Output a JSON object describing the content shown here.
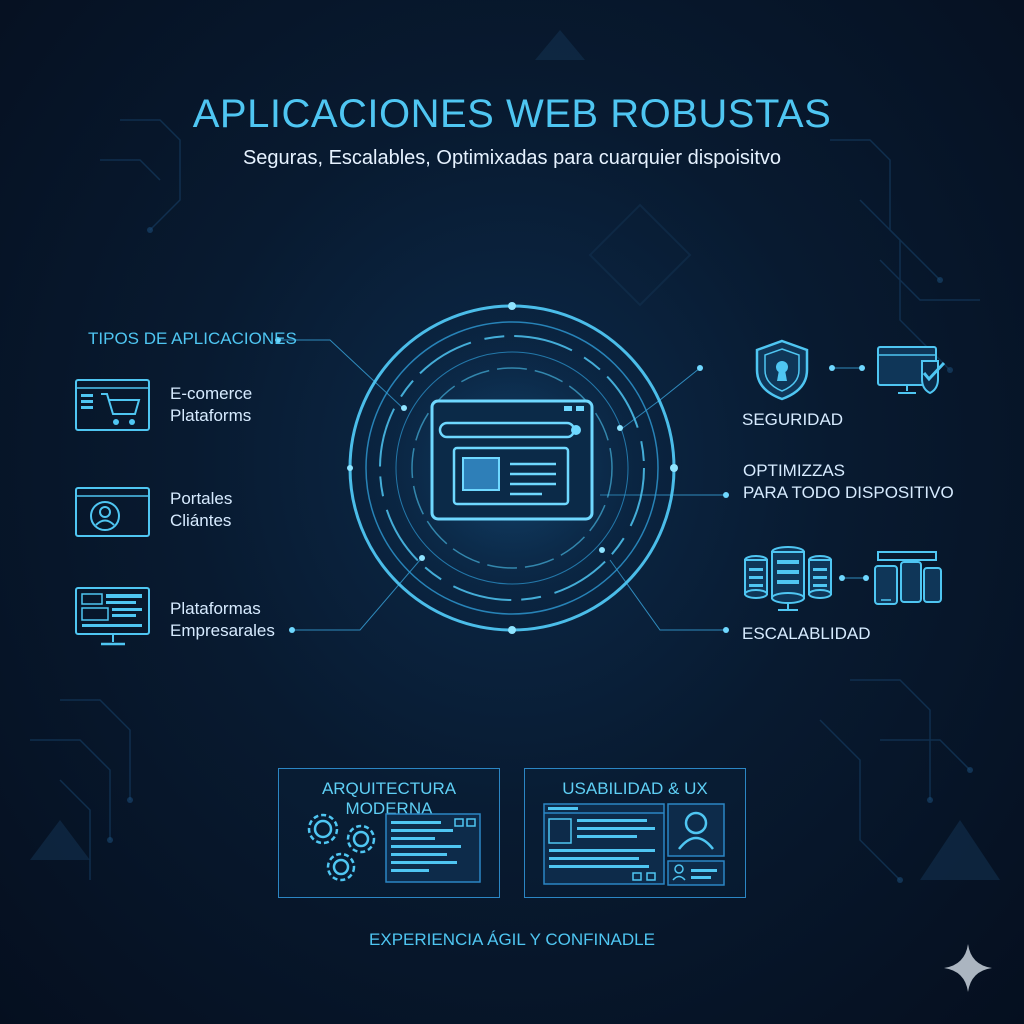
{
  "header": {
    "title": "APLICACIONES WEB ROBUSTAS",
    "subtitle": "Seguras, Escalables, Optimixadas para cuarquier dispoisitvo"
  },
  "left_panel": {
    "heading": "TIPOS DE APLICACIONES",
    "items": [
      {
        "line1": "E-comerce",
        "line2": "Plataforms",
        "icon": "shopping-cart-icon"
      },
      {
        "line1": "Portales",
        "line2": "Cliántes",
        "icon": "user-profile-icon"
      },
      {
        "line1": "Plataformas",
        "line2": "Empresarales",
        "icon": "dashboard-monitor-icon"
      }
    ]
  },
  "right_panel": {
    "security": {
      "label": "SEGURIDAD",
      "icons": [
        "shield-lock-icon",
        "monitor-check-icon"
      ]
    },
    "optimization": {
      "line1": "OPTIMIZZAS",
      "line2": "PARA TODO DISPOSITIVO"
    },
    "scalability": {
      "label": "ESCALABLIDAD",
      "icons": [
        "server-stack-icon",
        "devices-icon"
      ]
    }
  },
  "center": {
    "icon": "browser-window-icon"
  },
  "cards": [
    {
      "title": "ARQUITECTURA MODERNA",
      "icon": "gears-icon"
    },
    {
      "title": "USABILIDAD & UX",
      "icon": "user-avatar-icon"
    }
  ],
  "footer": {
    "tagline": "EXPERIENCIA ÁGIL Y CONFINADLE"
  },
  "colors": {
    "accent": "#4fc6f2",
    "background": "#081a30",
    "line": "#2b86c4"
  }
}
